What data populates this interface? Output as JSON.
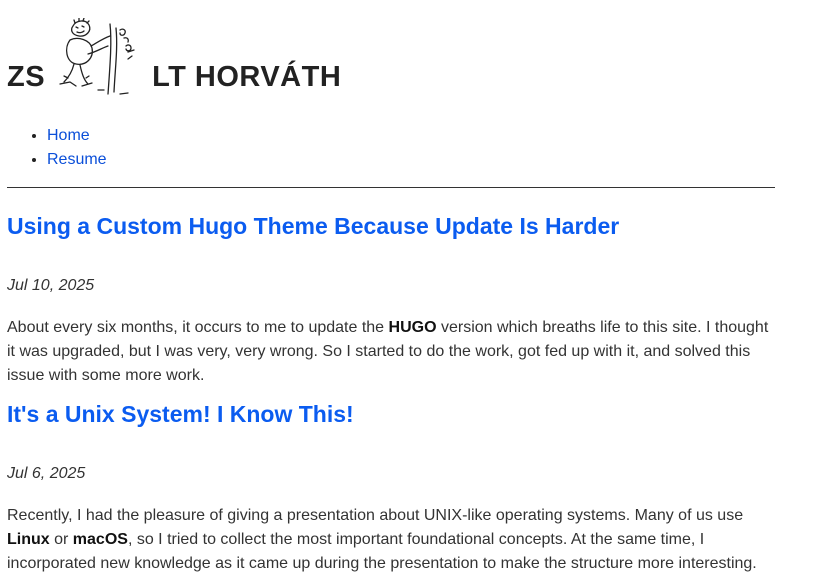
{
  "site": {
    "title_left": "ZS",
    "title_right": "LT HORVÁTH",
    "logo_icon": "stick-figure-doodle-icon"
  },
  "nav": {
    "items": [
      {
        "label": "Home"
      },
      {
        "label": "Resume"
      }
    ]
  },
  "colors": {
    "link": "#0b4fd9",
    "post_title": "#0b5cf0",
    "text": "#333333"
  },
  "posts": [
    {
      "title": "Using a Custom Hugo Theme Because Update Is Harder",
      "date": "Jul 10, 2025",
      "summary": [
        {
          "text": "About every six months, it occurs to me to update the ",
          "bold": false
        },
        {
          "text": "HUGO",
          "bold": true
        },
        {
          "text": " version which breaths life to this site. I thought it was upgraded, but I was very, very wrong. So I started to do the work, got fed up with it, and solved this issue with some more work.",
          "bold": false
        }
      ]
    },
    {
      "title": "It's a Unix System! I Know This!",
      "date": "Jul 6, 2025",
      "summary": [
        {
          "text": "Recently, I had the pleasure of giving a presentation about UNIX-like operating systems. Many of us use ",
          "bold": false
        },
        {
          "text": "Linux",
          "bold": true
        },
        {
          "text": " or ",
          "bold": false
        },
        {
          "text": "macOS",
          "bold": true
        },
        {
          "text": ", so I tried to collect the most important foundational concepts. At the same time, I incorporated new knowledge as it came up during the presentation to make the structure more interesting.",
          "bold": false
        }
      ]
    }
  ]
}
